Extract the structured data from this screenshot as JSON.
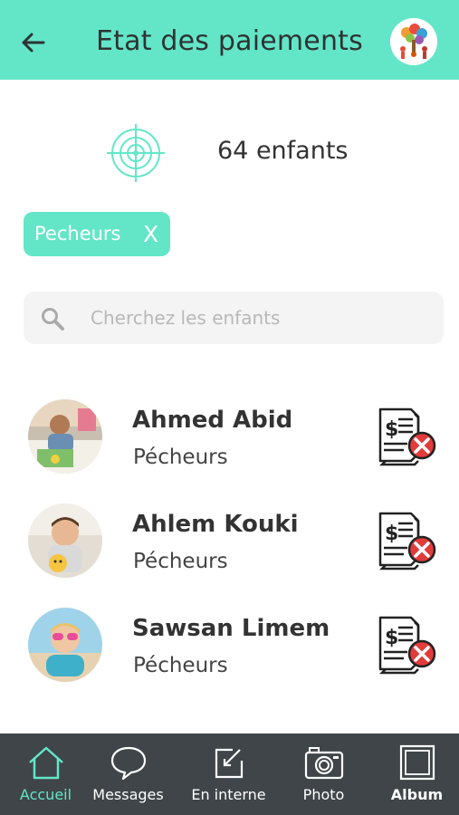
{
  "header": {
    "title": "Etat des paiements",
    "back_icon": "arrow-left-icon",
    "logo_icon": "school-logo-icon"
  },
  "counter": {
    "icon": "target-icon",
    "text": "64 enfants"
  },
  "filter_chip": {
    "label": "Pecheurs",
    "close": "X"
  },
  "search": {
    "placeholder": "Cherchez les enfants",
    "value": ""
  },
  "children": [
    {
      "name": "Ahmed Abid",
      "group": "Pécheurs",
      "status_icon": "unpaid-invoice-icon"
    },
    {
      "name": "Ahlem Kouki",
      "group": "Pécheurs",
      "status_icon": "unpaid-invoice-icon"
    },
    {
      "name": "Sawsan Limem",
      "group": "Pécheurs",
      "status_icon": "unpaid-invoice-icon"
    }
  ],
  "bottom_nav": {
    "items": [
      {
        "label": "Accueil",
        "icon": "home-icon",
        "active": true
      },
      {
        "label": "Messages",
        "icon": "chat-bubble-icon",
        "active": false
      },
      {
        "label": "En interne",
        "icon": "edit-square-icon",
        "active": false
      },
      {
        "label": "Photo",
        "icon": "camera-icon",
        "active": false
      },
      {
        "label": "Album",
        "icon": "album-icon",
        "active": false
      }
    ]
  },
  "colors": {
    "accent": "#63e6c8",
    "nav_background": "#3f4548",
    "unpaid_red": "#e23b3b",
    "text_dark": "#333333"
  }
}
